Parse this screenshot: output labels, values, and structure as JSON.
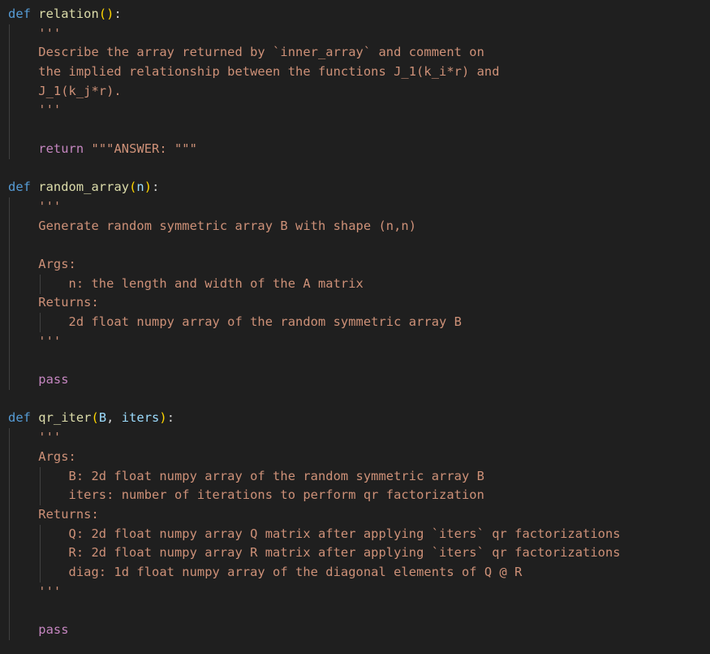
{
  "editor": {
    "functions": [
      {
        "keyword": "def",
        "name": "relation",
        "params": "",
        "docstring_open": "'''",
        "docstring_lines": [
          "Describe the array returned by `inner_array` and comment on",
          "the implied relationship between the functions J_1(k_i*r) and",
          "J_1(k_j*r)."
        ],
        "docstring_close": "'''",
        "return_keyword": "return",
        "return_value": "\"\"\"ANSWER: \"\"\""
      },
      {
        "keyword": "def",
        "name": "random_array",
        "params": "n",
        "docstring_open": "'''",
        "summary": "Generate random symmetric array B with shape (n,n)",
        "args_label": "Args:",
        "args": [
          "n: the length and width of the A matrix"
        ],
        "returns_label": "Returns:",
        "returns": [
          "2d float numpy array of the random symmetric array B"
        ],
        "docstring_close": "'''",
        "body": "pass"
      },
      {
        "keyword": "def",
        "name": "qr_iter",
        "params": [
          "B",
          "iters"
        ],
        "docstring_open": "'''",
        "args_label": "Args:",
        "args": [
          "B: 2d float numpy array of the random symmetric array B",
          "iters: number of iterations to perform qr factorization"
        ],
        "returns_label": "Returns:",
        "returns": [
          "Q: 2d float numpy array Q matrix after applying `iters` qr factorizations",
          "R: 2d float numpy array R matrix after applying `iters` qr factorizations",
          "diag: 1d float numpy array of the diagonal elements of Q @ R"
        ],
        "docstring_close": "'''",
        "body": "pass"
      }
    ],
    "punct": {
      "colon": ":",
      "comma": ", ",
      "lparen": "(",
      "rparen": ")"
    },
    "colors": {
      "background": "#1f1f1f",
      "keyword": "#569cd6",
      "function": "#dcdcaa",
      "string": "#ce9178",
      "control": "#c586c0",
      "parameter": "#9cdcfe",
      "bracket": "#ffd700"
    }
  }
}
